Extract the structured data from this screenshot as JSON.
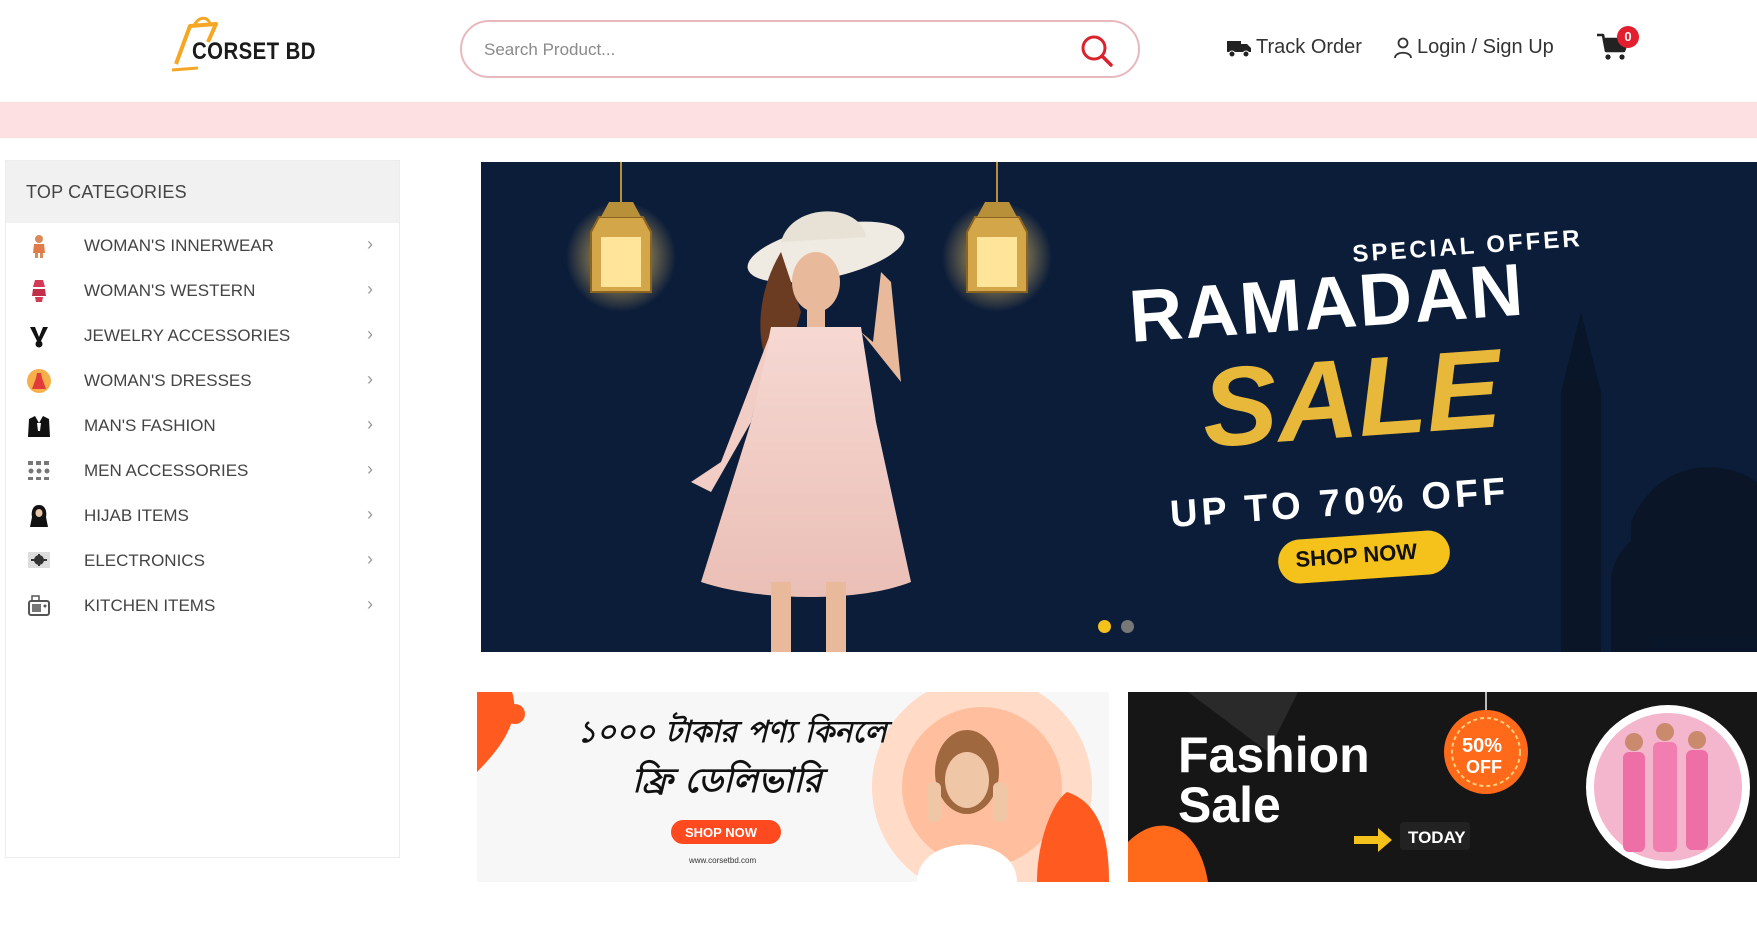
{
  "header": {
    "logo_text": "CORSET BD",
    "search_placeholder": "Search Product...",
    "track_order": "Track Order",
    "login_signup": "Login / Sign Up",
    "cart_count": "0"
  },
  "sidebar": {
    "title": "TOP CATEGORIES",
    "items": [
      {
        "label": "WOMAN'S INNERWEAR",
        "icon": "innerwear-icon"
      },
      {
        "label": "WOMAN'S WESTERN",
        "icon": "western-icon"
      },
      {
        "label": "JEWELRY ACCESSORIES",
        "icon": "jewelry-icon"
      },
      {
        "label": "WOMAN'S DRESSES",
        "icon": "dress-icon"
      },
      {
        "label": "MAN'S FASHION",
        "icon": "suit-icon"
      },
      {
        "label": "MEN ACCESSORIES",
        "icon": "accessories-icon"
      },
      {
        "label": "HIJAB ITEMS",
        "icon": "hijab-icon"
      },
      {
        "label": "ELECTRONICS",
        "icon": "electronics-icon"
      },
      {
        "label": "KITCHEN ITEMS",
        "icon": "kitchen-icon"
      }
    ]
  },
  "hero": {
    "special_offer": "SPECIAL OFFER",
    "ramadan": "RAMADAN",
    "sale": "SALE",
    "discount": "UP TO 70% OFF",
    "cta": "SHOP NOW",
    "active_slide": 1,
    "slide_count": 2
  },
  "promo_left": {
    "line1": "১০০০ টাকার পণ্য কিনলে",
    "line2": "ফ্রি ডেলিভারি",
    "cta": "SHOP NOW",
    "url": "www.corsetbd.com"
  },
  "promo_right": {
    "title_line1": "Fashion",
    "title_line2": "Sale",
    "badge_pct": "50%",
    "badge_off": "OFF",
    "today": "TODAY"
  },
  "colors": {
    "accent_red": "#e31e2e",
    "strip_pink": "#fde0e2",
    "hero_navy": "#0c1d3a",
    "gold": "#e8b83a",
    "orange": "#ff5a1f"
  }
}
